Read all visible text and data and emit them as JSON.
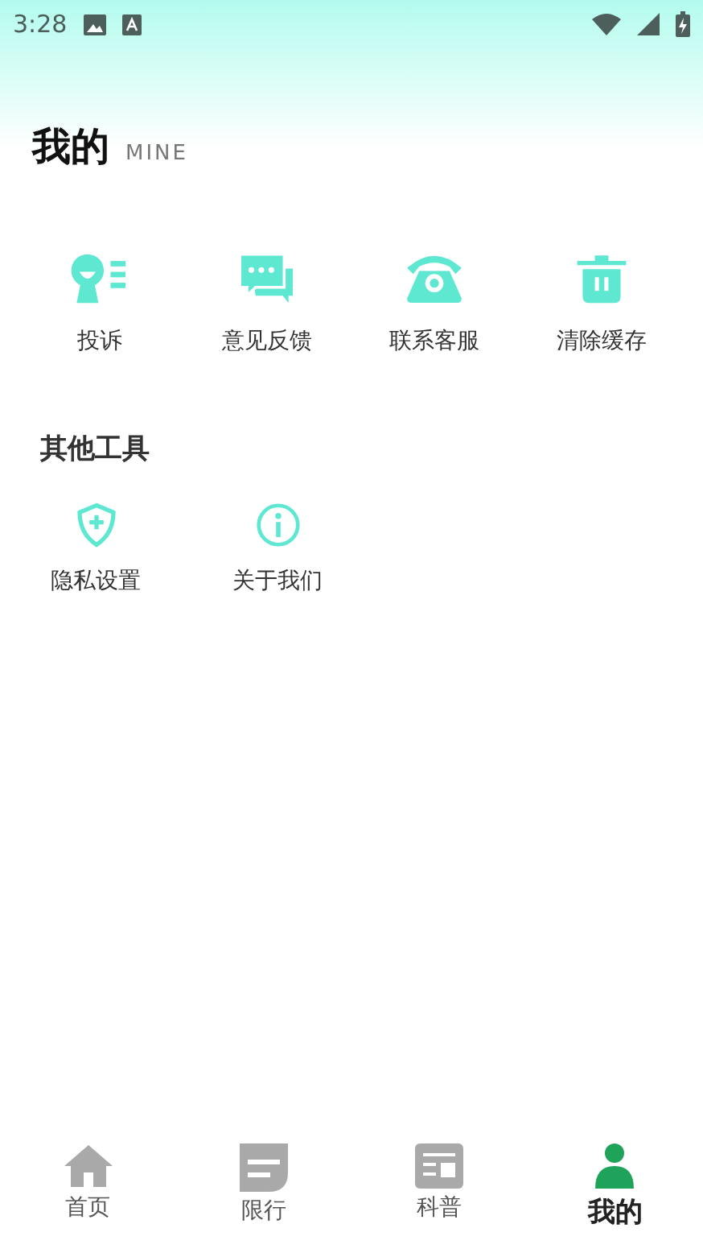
{
  "status_bar": {
    "time": "3:28"
  },
  "header": {
    "title": "我的",
    "subtitle": "MINE"
  },
  "services": [
    {
      "label": "投诉",
      "kind": "complaint"
    },
    {
      "label": "意见反馈",
      "kind": "feedback"
    },
    {
      "label": "联系客服",
      "kind": "phone"
    },
    {
      "label": "清除缓存",
      "kind": "trash"
    }
  ],
  "other_tools": {
    "title": "其他工具",
    "items": [
      {
        "label": "隐私设置",
        "kind": "shield"
      },
      {
        "label": "关于我们",
        "kind": "info"
      }
    ]
  },
  "tab_bar": [
    {
      "label": "首页",
      "kind": "home",
      "selected": false
    },
    {
      "label": "限行",
      "kind": "note",
      "selected": false
    },
    {
      "label": "科普",
      "kind": "news",
      "selected": false
    },
    {
      "label": "我的",
      "kind": "person",
      "selected": true
    }
  ]
}
